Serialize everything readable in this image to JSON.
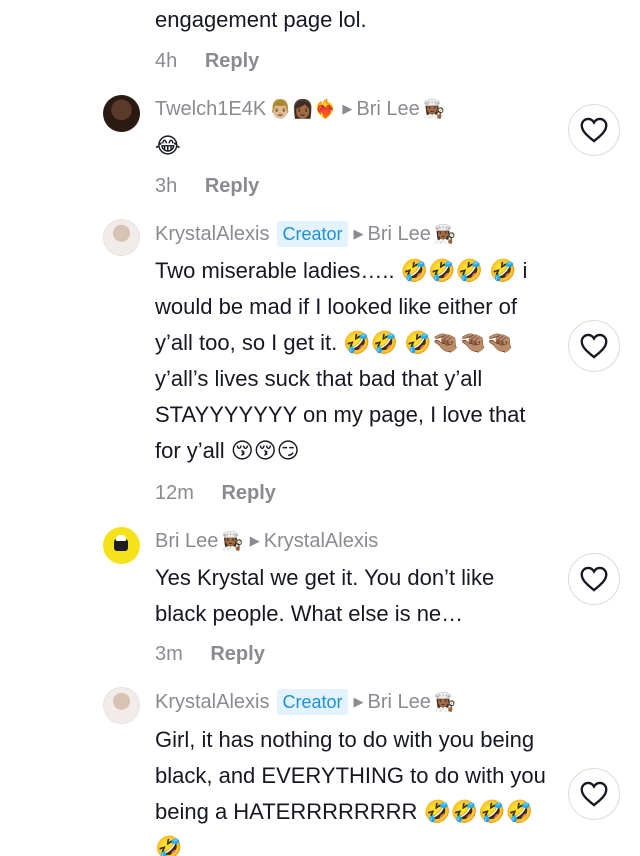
{
  "comments": [
    {
      "id": "c0",
      "body": "engagement page lol.",
      "time": "4h",
      "reply": "Reply"
    },
    {
      "id": "c1",
      "username": "Twelch1E4K",
      "username_emoji": "👨🏼👩🏾❤️‍🔥",
      "reply_to": "Bri Lee",
      "reply_to_emoji": "👩🏾‍🍳",
      "body": "😂",
      "time": "3h",
      "reply": "Reply"
    },
    {
      "id": "c2",
      "username": "KrystalAlexis",
      "badge": "Creator",
      "reply_to": "Bri Lee",
      "reply_to_emoji": "👩🏾‍🍳",
      "body": " Two miserable ladies….. 🤣🤣🤣 🤣 i would be mad if I looked like either of y’all too, so I get it. 🤣🤣 🤣🤏🏽🤏🏽🤏🏽 y’all’s lives suck that bad that y’all STAYYYYYYY on my page, I love that for y’all 😚😚😏",
      "time": "12m",
      "reply": "Reply"
    },
    {
      "id": "c3",
      "username": "Bri Lee",
      "username_emoji": "👩🏾‍🍳",
      "reply_to": "KrystalAlexis",
      "body": " Yes Krystal we get it. You don’t like black people. What else is ne…",
      "time": "3m",
      "reply": "Reply"
    },
    {
      "id": "c4",
      "username": "KrystalAlexis",
      "badge": "Creator",
      "reply_to": "Bri Lee",
      "reply_to_emoji": "👩🏾‍🍳",
      "body": " Girl, it has nothing to do with you being black, and EVERYTHING to do with you being a HATERRRRRRRR 🤣🤣🤣🤣🤣"
    }
  ],
  "icons": {
    "like": "heart-outline-icon",
    "arrow": "caret-right-icon"
  },
  "colors": {
    "text": "#161823",
    "muted": "#8a8b91",
    "creator_badge_bg": "#e3f2fd",
    "creator_badge_text": "#1b92d8"
  }
}
